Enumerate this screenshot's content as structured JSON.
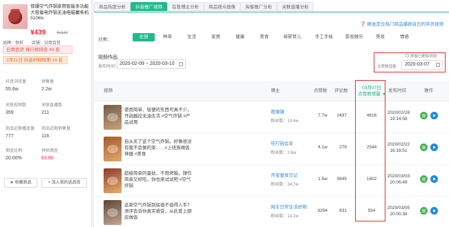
{
  "product": {
    "title": "惊爆空气炸锅家用智能多功能大容量电炸锅无油电脑薯条机5106ts",
    "price": "¥439",
    "orig_price": "¥2110",
    "shop_label": "品牌：惊样",
    "channel_label": "店铺：日用百货",
    "tag_rank": "日用百货 排行榜排名 40 名",
    "tag_trend": "2月21日 抖音好物榜第 18 名"
  },
  "stats": [
    {
      "label": "抖音浏览量",
      "value": "55.6w"
    },
    {
      "label": "销售量",
      "value": "2.2w"
    },
    {
      "label": "关联视频数",
      "value": "359"
    },
    {
      "label": "关联直播数",
      "value": "211"
    },
    {
      "label": "商品近期播放量",
      "value": "777"
    },
    {
      "label": "商品近期销售量",
      "value": "116"
    },
    {
      "label": "佣金比例",
      "value": "20.00%"
    },
    {
      "label": "预估佣金",
      "value": "63.80"
    }
  ],
  "left_buttons": {
    "collect": "★ 收藏商品",
    "add_library": "+ 加入我的选品库"
  },
  "tabs": [
    "商品热度分析",
    "抖音推广视频",
    "在售博主分析",
    "商品观众画像",
    "淘客推广分析",
    "关联直播分析"
  ],
  "active_tab": 1,
  "notice": "❓ 精准定位热门商品爆款自日的带货视频",
  "category": {
    "label": "分类：",
    "items": [
      "全部",
      "种草",
      "生活",
      "家居",
      "健康",
      "美食",
      "母婴育儿",
      "手工手绘",
      "影视娱乐",
      "美妆",
      "情感"
    ]
  },
  "section_title": "视频作品",
  "filter": {
    "date_label": "发布时间：",
    "date_range": "2020-02-09 ~ 2020-03-10",
    "hide_label": "屏蔽已删除视频",
    "click_label": "点赞数增量：",
    "click_date": "2020-03-07"
  },
  "table": {
    "headers": {
      "video": "视频",
      "blogger": "博主",
      "likes": "点赞数",
      "comments": "评论数",
      "shares": "转发数",
      "increment_line1": "03月07日",
      "increment_line2": "点赞数增量",
      "publish_time": "发布时间",
      "ops": "操作"
    },
    "rows": [
      {
        "desc": "使用简单、轻便的东西可真不少，开启触控无油生活 #空气炸锅 #产品试用",
        "blogger": "鹿锤锤",
        "fans": "粉丝数：19.4w",
        "likes": "7.7w",
        "comments": "2497",
        "shares": "",
        "increment": "4816",
        "date": "2020/02/28",
        "time": "19:14:58"
      },
      {
        "desc": "自从买了这个空气炸锅，好像很没有我不会做的菜……#上班族做饭神器 #美食",
        "blogger": "吃叮猫会享",
        "fans": "粉丝数：2.6w",
        "likes": "4.1w",
        "comments": "278",
        "shares": "",
        "increment": "2544",
        "date": "2020/02/22",
        "time": "16:18:51"
      },
      {
        "desc": "超级简单的蛋挞，不用烤箱，操作简单又好吃，你也来试试吧 #空气炸锅",
        "blogger": "开宝健食日记",
        "fans": "粉丝数：34.7w",
        "likes": "1.5w",
        "comments": "3845",
        "shares": "",
        "increment": "1602",
        "date": "2020/03/03",
        "time": "20:06:49"
      },
      {
        "desc": "这款空气炸锅到底值不值得入手？测评告诉你真实感受，从此爱上厨房做饭",
        "blogger": "网丰日常生活好物",
        "fans": "粉丝数：14.2w",
        "likes": "3294",
        "comments": "831",
        "shares": "",
        "increment": "934",
        "date": "2020/03/05",
        "time": "20:00:38"
      }
    ]
  },
  "colors": {
    "accent": "#1fb98f",
    "price": "#f5222d",
    "highlight_box": "#e0302a",
    "link": "#2f8ddc"
  }
}
